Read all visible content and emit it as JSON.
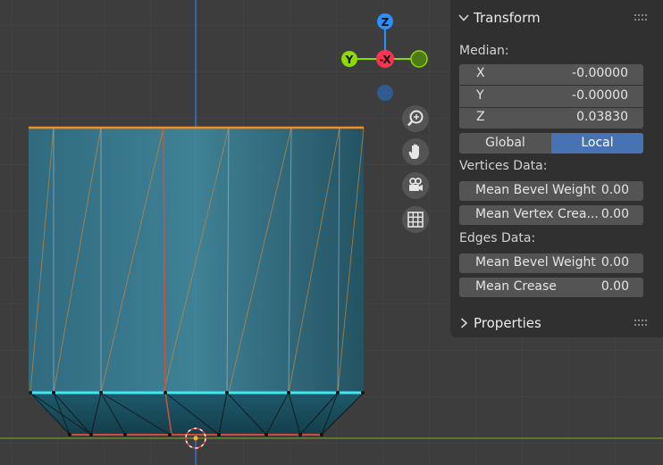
{
  "gizmo": {
    "z": "Z",
    "y": "Y",
    "x": "-X"
  },
  "nav_icons": [
    "zoom-icon",
    "pan-hand-icon",
    "camera-icon",
    "grid-icon"
  ],
  "transform_panel": {
    "title": "Transform",
    "median_label": "Median:",
    "x": {
      "label": "X",
      "value": "-0.00000"
    },
    "y": {
      "label": "Y",
      "value": "-0.00000"
    },
    "z": {
      "label": "Z",
      "value": "0.03830"
    },
    "space": {
      "global": "Global",
      "local": "Local",
      "selected": "Local"
    },
    "vertices_heading": "Vertices Data:",
    "vert_bevel": {
      "label": "Mean Bevel Weight",
      "value": "0.00"
    },
    "vert_crease": {
      "label": "Mean Vertex Crea...",
      "value": "0.00"
    },
    "edges_heading": "Edges Data:",
    "edge_bevel": {
      "label": "Mean Bevel Weight",
      "value": "0.00"
    },
    "edge_crease": {
      "label": "Mean Crease",
      "value": "0.00"
    }
  },
  "properties_panel": {
    "title": "Properties"
  },
  "colors": {
    "viewport_bg": "#3d3d3d",
    "panel_bg": "#303030",
    "field_bg": "#545454",
    "accent": "#4772b3",
    "axis_x": "#ff3352",
    "axis_y": "#8bdc00",
    "axis_z": "#2c8fff",
    "selected_edge": "#ff8a1a",
    "active_edge": "#00ffff"
  }
}
